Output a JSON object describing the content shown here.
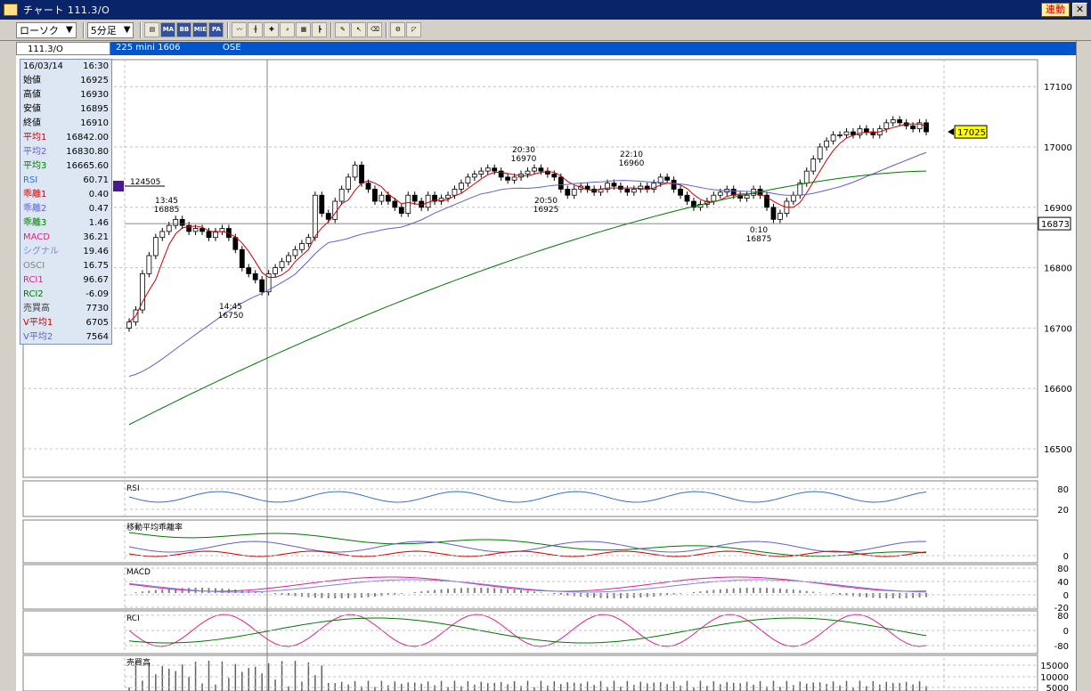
{
  "window": {
    "title": "チャート  111.3/O",
    "link_button": "連動",
    "close_button": "✕"
  },
  "toolbar": {
    "chart_type": "ローソク",
    "timeframe": "5分足",
    "icons": [
      "chart-settings-icon",
      "MA",
      "BB",
      "MIE",
      "PA",
      "line-chart-icon",
      "candle-style-icon",
      "crosshair-icon",
      "zoom-icon",
      "grid-icon",
      "bar-layout-icon",
      "pen-icon",
      "cursor-icon",
      "eraser-icon",
      "settings-icon",
      "pencil-ruler-icon"
    ]
  },
  "tabs": {
    "symbol": "111.3/O",
    "product": "225 mini 1606",
    "exchange": "OSE"
  },
  "info": [
    {
      "label": "16/03/14",
      "value": "16:30",
      "color": "#000000"
    },
    {
      "label": "始値",
      "value": "16925",
      "color": "#000000"
    },
    {
      "label": "高値",
      "value": "16930",
      "color": "#000000"
    },
    {
      "label": "安値",
      "value": "16895",
      "color": "#000000"
    },
    {
      "label": "終値",
      "value": "16910",
      "color": "#000000"
    },
    {
      "label": "平均1",
      "value": "16842.00",
      "color": "#cc0000"
    },
    {
      "label": "平均2",
      "value": "16830.80",
      "color": "#6060cc"
    },
    {
      "label": "平均3",
      "value": "16665.60",
      "color": "#007700"
    },
    {
      "label": "RSI",
      "value": "60.71",
      "color": "#3070d0"
    },
    {
      "label": "乖離1",
      "value": "0.40",
      "color": "#cc0000"
    },
    {
      "label": "乖離2",
      "value": "0.47",
      "color": "#6060cc"
    },
    {
      "label": "乖離3",
      "value": "1.46",
      "color": "#007700"
    },
    {
      "label": "MACD",
      "value": "36.21",
      "color": "#e0208a"
    },
    {
      "label": "シグナル",
      "value": "19.46",
      "color": "#8080e0"
    },
    {
      "label": "OSCI",
      "value": "16.75",
      "color": "#808080"
    },
    {
      "label": "RCI1",
      "value": "96.67",
      "color": "#e0208a"
    },
    {
      "label": "RCI2",
      "value": "-6.09",
      "color": "#007700"
    },
    {
      "label": "売買高",
      "value": "7730",
      "color": "#404040"
    },
    {
      "label": "V平均1",
      "value": "6705",
      "color": "#cc0000"
    },
    {
      "label": "V平均2",
      "value": "7564",
      "color": "#6060cc"
    }
  ],
  "chart_data": {
    "type": "candlestick",
    "price_axis": {
      "ticks": [
        17100,
        17000,
        16900,
        16800,
        16700,
        16600,
        16500
      ],
      "range": [
        16450,
        17150
      ]
    },
    "current_price": "17025",
    "crosshair_price": "16873",
    "volume_marker": "124505",
    "annotations": [
      {
        "time": "13:45",
        "price": "16885",
        "kind": "high"
      },
      {
        "time": "14:45",
        "price": "16750",
        "kind": "low"
      },
      {
        "time": "20:30",
        "price": "16970",
        "kind": "high"
      },
      {
        "time": "20:50",
        "price": "16925",
        "kind": "low"
      },
      {
        "time": "22:10",
        "price": "16960",
        "kind": "high"
      },
      {
        "time": "0:10",
        "price": "16875",
        "kind": "low"
      }
    ],
    "close_series": [
      16710,
      16730,
      16790,
      16820,
      16850,
      16860,
      16870,
      16880,
      16870,
      16860,
      16865,
      16860,
      16850,
      16860,
      16865,
      16850,
      16830,
      16800,
      16790,
      16780,
      16760,
      16790,
      16800,
      16810,
      16820,
      16830,
      16840,
      16850,
      16920,
      16890,
      16880,
      16910,
      16930,
      16950,
      16970,
      16940,
      16930,
      16910,
      16920,
      16910,
      16900,
      16890,
      16920,
      16910,
      16900,
      16920,
      16910,
      16915,
      16920,
      16930,
      16940,
      16950,
      16955,
      16960,
      16965,
      16960,
      16950,
      16945,
      16950,
      16955,
      16960,
      16965,
      16960,
      16955,
      16950,
      16930,
      16920,
      16930,
      16935,
      16930,
      16925,
      16930,
      16940,
      16935,
      16930,
      16925,
      16930,
      16935,
      16930,
      16940,
      16950,
      16945,
      16930,
      16920,
      16910,
      16900,
      16905,
      16910,
      16920,
      16925,
      16930,
      16920,
      16915,
      16920,
      16930,
      16920,
      16900,
      16880,
      16890,
      16910,
      16920,
      16940,
      16960,
      16980,
      17000,
      17010,
      17020,
      17020,
      17025,
      17020,
      17030,
      17025,
      17020,
      17030,
      17040,
      17045,
      17040,
      17035,
      17030,
      17040,
      17025
    ],
    "ma1_start": 16700,
    "ma2_start": 16620,
    "ma3_start": 16540,
    "ma3_end": 16960,
    "panels": [
      {
        "name": "RSI",
        "ticks": [
          "80",
          "20"
        ]
      },
      {
        "name": "移動平均乖離率",
        "ticks": [
          "0"
        ]
      },
      {
        "name": "MACD",
        "ticks": [
          "80",
          "40",
          "0",
          "-20"
        ]
      },
      {
        "name": "RCI",
        "ticks": [
          "80",
          "0",
          "-80"
        ]
      },
      {
        "name": "売買高",
        "ticks": [
          "15000",
          "10000",
          "5000"
        ]
      }
    ]
  }
}
